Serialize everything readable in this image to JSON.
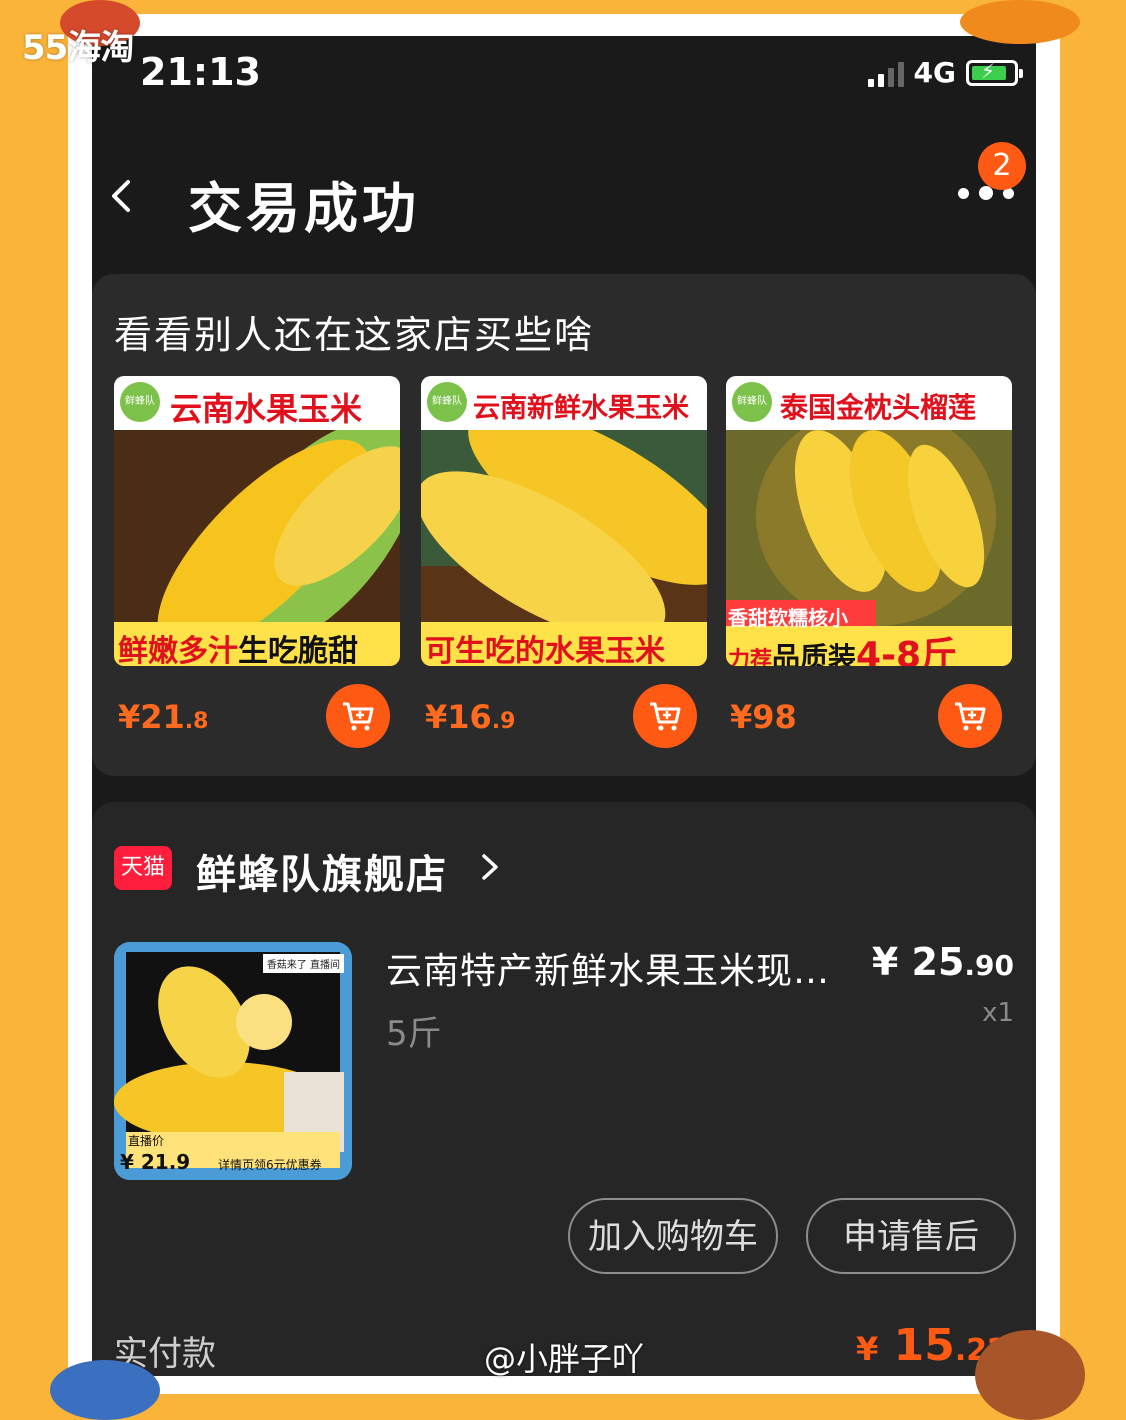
{
  "watermark": {
    "site": "55海淘",
    "handle": "@小胖子吖"
  },
  "status_bar": {
    "time": "21:13",
    "network": "4G"
  },
  "nav": {
    "back_icon": "chevron-left-icon",
    "title": "交易成功",
    "more_icon": "more-dots-icon",
    "badge": "2"
  },
  "recommendations": {
    "title": "看看别人还在这家店买些啥",
    "items": [
      {
        "banner": "云南水果玉米",
        "caption_left": "鲜嫩多汁",
        "caption_right": "生吃脆甜",
        "brand": "鲜蜂队",
        "price_main": "¥21",
        "price_dec": ".8"
      },
      {
        "banner": "云南新鲜水果玉米",
        "caption_left": "可生吃的水果玉米",
        "caption_right": "",
        "brand": "鲜蜂队",
        "price_main": "¥16",
        "price_dec": ".9"
      },
      {
        "banner": "泰国金枕头榴莲",
        "caption_top": "香甜软糯核小",
        "caption_left": "力荐",
        "caption_mid": "品质装",
        "caption_right": "4-8斤",
        "brand": "鲜蜂队",
        "price_main": "¥98",
        "price_dec": ""
      }
    ]
  },
  "shop": {
    "badge": "天猫",
    "name": "鲜蜂队旗舰店",
    "chevron": "›"
  },
  "product": {
    "title": "云南特产新鲜水果玉米现…",
    "spec": "5斤",
    "price_main": "¥ 25",
    "price_dec": ".90",
    "qty": "x1",
    "thumb": {
      "tag": "香菇来了 直播间",
      "live_label": "直播价",
      "live_price": "¥ 21.9",
      "coupon": "详情页领6元优惠券"
    }
  },
  "actions": {
    "add_to_cart": "加入购物车",
    "after_sales": "申请售后"
  },
  "payment": {
    "label": "实付款",
    "currency": "¥",
    "main": "15",
    "dec": ".22"
  },
  "colors": {
    "accent": "#ff5a14",
    "tmall": "#ff1f3d",
    "frame_bg": "#fbb43a"
  }
}
